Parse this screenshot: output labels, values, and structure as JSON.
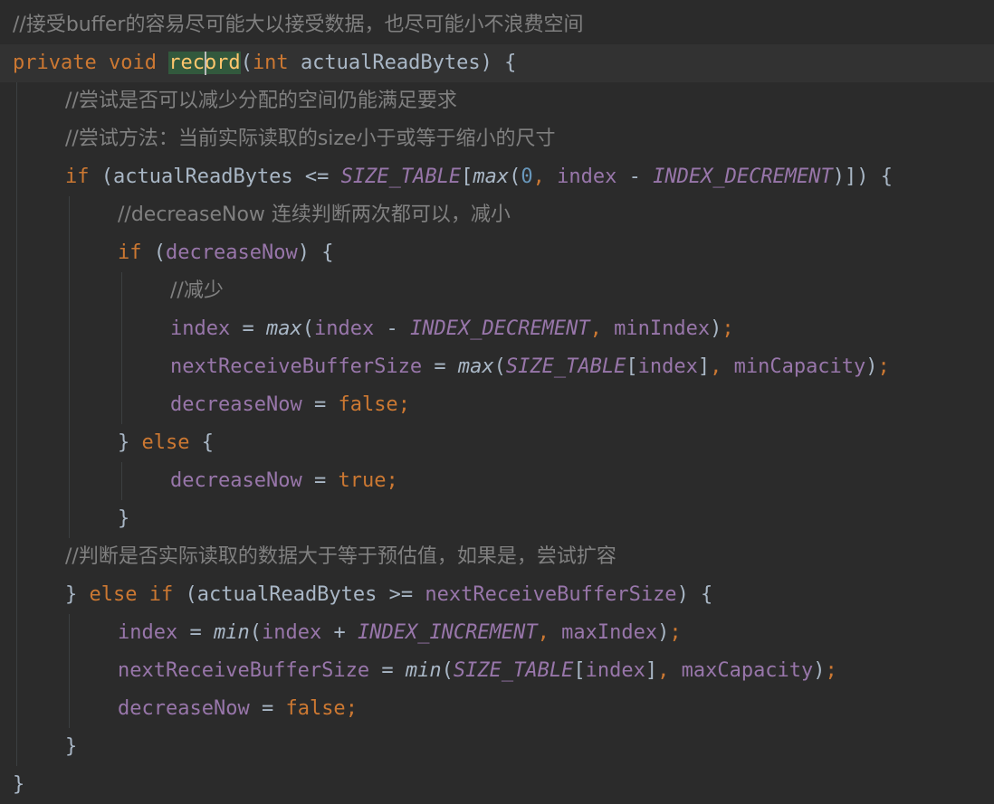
{
  "editor": {
    "colors": {
      "background": "#2b2b2b",
      "current_line": "#323232",
      "comment": "#808080",
      "keyword": "#cc7832",
      "method": "#ffc66d",
      "field": "#9876aa",
      "number": "#6897bb",
      "text": "#a9b7c6",
      "highlight": "#32593d"
    },
    "lines": [
      {
        "indent": 0,
        "tokens": [
          {
            "t": "//接受buffer的容易尽可能大以接受数据，也尽可能小不浪费空间",
            "k": "comment"
          }
        ]
      },
      {
        "indent": 0,
        "current": true,
        "tokens": [
          {
            "t": "private",
            "k": "keyword"
          },
          {
            "t": " ",
            "k": "plain"
          },
          {
            "t": "void",
            "k": "keyword"
          },
          {
            "t": " ",
            "k": "plain"
          },
          {
            "t": "record",
            "k": "method",
            "hl": true
          },
          {
            "t": "(",
            "k": "punct"
          },
          {
            "t": "int",
            "k": "keyword"
          },
          {
            "t": " ",
            "k": "plain"
          },
          {
            "t": "actualReadBytes",
            "k": "param"
          },
          {
            "t": ") {",
            "k": "punct"
          }
        ]
      },
      {
        "indent": 1,
        "tokens": [
          {
            "t": "//尝试是否可以减少分配的空间仍能满足要求",
            "k": "comment"
          }
        ]
      },
      {
        "indent": 1,
        "tokens": [
          {
            "t": "//尝试方法：当前实际读取的size小于或等于缩小的尺寸",
            "k": "comment"
          }
        ]
      },
      {
        "indent": 1,
        "tokens": [
          {
            "t": "if",
            "k": "keyword"
          },
          {
            "t": " (",
            "k": "punct"
          },
          {
            "t": "actualReadBytes",
            "k": "param"
          },
          {
            "t": " <= ",
            "k": "op"
          },
          {
            "t": "SIZE_TABLE",
            "k": "static"
          },
          {
            "t": "[",
            "k": "punct"
          },
          {
            "t": "max",
            "k": "call"
          },
          {
            "t": "(",
            "k": "punct"
          },
          {
            "t": "0",
            "k": "number"
          },
          {
            "t": ",",
            "k": "semi"
          },
          {
            "t": " ",
            "k": "plain"
          },
          {
            "t": "index",
            "k": "field"
          },
          {
            "t": " - ",
            "k": "op"
          },
          {
            "t": "INDEX_DECREMENT",
            "k": "static"
          },
          {
            "t": ")]) {",
            "k": "punct"
          }
        ]
      },
      {
        "indent": 2,
        "tokens": [
          {
            "t": "//decreaseNow 连续判断两次都可以，减小",
            "k": "comment"
          }
        ]
      },
      {
        "indent": 2,
        "tokens": [
          {
            "t": "if",
            "k": "keyword"
          },
          {
            "t": " (",
            "k": "punct"
          },
          {
            "t": "decreaseNow",
            "k": "field"
          },
          {
            "t": ") {",
            "k": "punct"
          }
        ]
      },
      {
        "indent": 3,
        "tokens": [
          {
            "t": "//减少",
            "k": "comment"
          }
        ]
      },
      {
        "indent": 3,
        "tokens": [
          {
            "t": "index",
            "k": "field"
          },
          {
            "t": " = ",
            "k": "op"
          },
          {
            "t": "max",
            "k": "call"
          },
          {
            "t": "(",
            "k": "punct"
          },
          {
            "t": "index",
            "k": "field"
          },
          {
            "t": " - ",
            "k": "op"
          },
          {
            "t": "INDEX_DECREMENT",
            "k": "static"
          },
          {
            "t": ",",
            "k": "semi"
          },
          {
            "t": " ",
            "k": "plain"
          },
          {
            "t": "minIndex",
            "k": "field"
          },
          {
            "t": ")",
            "k": "punct"
          },
          {
            "t": ";",
            "k": "semi"
          }
        ]
      },
      {
        "indent": 3,
        "tokens": [
          {
            "t": "nextReceiveBufferSize",
            "k": "field"
          },
          {
            "t": " = ",
            "k": "op"
          },
          {
            "t": "max",
            "k": "call"
          },
          {
            "t": "(",
            "k": "punct"
          },
          {
            "t": "SIZE_TABLE",
            "k": "static"
          },
          {
            "t": "[",
            "k": "punct"
          },
          {
            "t": "index",
            "k": "field"
          },
          {
            "t": "]",
            "k": "punct"
          },
          {
            "t": ",",
            "k": "semi"
          },
          {
            "t": " ",
            "k": "plain"
          },
          {
            "t": "minCapacity",
            "k": "field"
          },
          {
            "t": ")",
            "k": "punct"
          },
          {
            "t": ";",
            "k": "semi"
          }
        ]
      },
      {
        "indent": 3,
        "tokens": [
          {
            "t": "decreaseNow",
            "k": "field"
          },
          {
            "t": " = ",
            "k": "op"
          },
          {
            "t": "false",
            "k": "keyword"
          },
          {
            "t": ";",
            "k": "semi"
          }
        ]
      },
      {
        "indent": 2,
        "tokens": [
          {
            "t": "} ",
            "k": "punct"
          },
          {
            "t": "else",
            "k": "keyword"
          },
          {
            "t": " {",
            "k": "punct"
          }
        ]
      },
      {
        "indent": 3,
        "tokens": [
          {
            "t": "decreaseNow",
            "k": "field"
          },
          {
            "t": " = ",
            "k": "op"
          },
          {
            "t": "true",
            "k": "keyword"
          },
          {
            "t": ";",
            "k": "semi"
          }
        ]
      },
      {
        "indent": 2,
        "tokens": [
          {
            "t": "}",
            "k": "punct"
          }
        ]
      },
      {
        "indent": 1,
        "tokens": [
          {
            "t": "//判断是否实际读取的数据大于等于预估值，如果是，尝试扩容",
            "k": "comment"
          }
        ]
      },
      {
        "indent": 1,
        "tokens": [
          {
            "t": "} ",
            "k": "punct"
          },
          {
            "t": "else",
            "k": "keyword"
          },
          {
            "t": " ",
            "k": "plain"
          },
          {
            "t": "if",
            "k": "keyword"
          },
          {
            "t": " (",
            "k": "punct"
          },
          {
            "t": "actualReadBytes",
            "k": "param"
          },
          {
            "t": " >= ",
            "k": "op"
          },
          {
            "t": "nextReceiveBufferSize",
            "k": "field"
          },
          {
            "t": ") {",
            "k": "punct"
          }
        ]
      },
      {
        "indent": 2,
        "tokens": [
          {
            "t": "index",
            "k": "field"
          },
          {
            "t": " = ",
            "k": "op"
          },
          {
            "t": "min",
            "k": "call"
          },
          {
            "t": "(",
            "k": "punct"
          },
          {
            "t": "index",
            "k": "field"
          },
          {
            "t": " + ",
            "k": "op"
          },
          {
            "t": "INDEX_INCREMENT",
            "k": "static"
          },
          {
            "t": ",",
            "k": "semi"
          },
          {
            "t": " ",
            "k": "plain"
          },
          {
            "t": "maxIndex",
            "k": "field"
          },
          {
            "t": ")",
            "k": "punct"
          },
          {
            "t": ";",
            "k": "semi"
          }
        ]
      },
      {
        "indent": 2,
        "tokens": [
          {
            "t": "nextReceiveBufferSize",
            "k": "field"
          },
          {
            "t": " = ",
            "k": "op"
          },
          {
            "t": "min",
            "k": "call"
          },
          {
            "t": "(",
            "k": "punct"
          },
          {
            "t": "SIZE_TABLE",
            "k": "static"
          },
          {
            "t": "[",
            "k": "punct"
          },
          {
            "t": "index",
            "k": "field"
          },
          {
            "t": "]",
            "k": "punct"
          },
          {
            "t": ",",
            "k": "semi"
          },
          {
            "t": " ",
            "k": "plain"
          },
          {
            "t": "maxCapacity",
            "k": "field"
          },
          {
            "t": ")",
            "k": "punct"
          },
          {
            "t": ";",
            "k": "semi"
          }
        ]
      },
      {
        "indent": 2,
        "tokens": [
          {
            "t": "decreaseNow",
            "k": "field"
          },
          {
            "t": " = ",
            "k": "op"
          },
          {
            "t": "false",
            "k": "keyword"
          },
          {
            "t": ";",
            "k": "semi"
          }
        ]
      },
      {
        "indent": 1,
        "tokens": [
          {
            "t": "}",
            "k": "punct"
          }
        ]
      },
      {
        "indent": 0,
        "tokens": [
          {
            "t": "}",
            "k": "punct"
          }
        ]
      }
    ]
  }
}
